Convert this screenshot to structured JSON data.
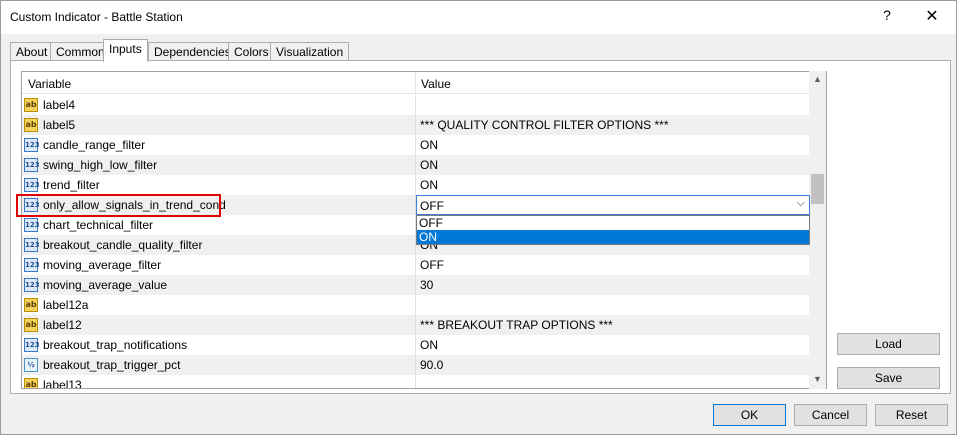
{
  "window": {
    "title": "Custom Indicator - Battle Station",
    "help_label": "?",
    "close_label": "✕"
  },
  "tabs": [
    {
      "label": "About"
    },
    {
      "label": "Common"
    },
    {
      "label": "Inputs"
    },
    {
      "label": "Dependencies"
    },
    {
      "label": "Colors"
    },
    {
      "label": "Visualization"
    }
  ],
  "active_tab": "Inputs",
  "grid": {
    "columns": {
      "variable": "Variable",
      "value": "Value"
    },
    "rows": [
      {
        "icon": "ab",
        "icon_text": "ab",
        "name": "label4",
        "value": ""
      },
      {
        "icon": "ab",
        "icon_text": "ab",
        "name": "label5",
        "value": "*** QUALITY CONTROL FILTER OPTIONS ***"
      },
      {
        "icon": "num",
        "icon_text": "123",
        "name": "candle_range_filter",
        "value": "ON"
      },
      {
        "icon": "num",
        "icon_text": "123",
        "name": "swing_high_low_filter",
        "value": "ON"
      },
      {
        "icon": "num",
        "icon_text": "123",
        "name": "trend_filter",
        "value": "ON"
      },
      {
        "icon": "num",
        "icon_text": "123",
        "name": "only_allow_signals_in_trend_cond",
        "value": ""
      },
      {
        "icon": "num",
        "icon_text": "123",
        "name": "chart_technical_filter",
        "value": ""
      },
      {
        "icon": "num",
        "icon_text": "123",
        "name": "breakout_candle_quality_filter",
        "value": "ON"
      },
      {
        "icon": "num",
        "icon_text": "123",
        "name": "moving_average_filter",
        "value": "OFF"
      },
      {
        "icon": "num",
        "icon_text": "123",
        "name": "moving_average_value",
        "value": "30"
      },
      {
        "icon": "ab",
        "icon_text": "ab",
        "name": "label12a",
        "value": ""
      },
      {
        "icon": "ab",
        "icon_text": "ab",
        "name": "label12",
        "value": "*** BREAKOUT TRAP OPTIONS ***"
      },
      {
        "icon": "num",
        "icon_text": "123",
        "name": "breakout_trap_notifications",
        "value": "ON"
      },
      {
        "icon": "frac",
        "icon_text": "½",
        "name": "breakout_trap_trigger_pct",
        "value": "90.0"
      },
      {
        "icon": "ab",
        "icon_text": "ab",
        "name": "label13",
        "value": ""
      }
    ]
  },
  "editor": {
    "selected_value": "OFF",
    "options": [
      "OFF",
      "ON"
    ],
    "highlighted_option": "ON",
    "chevron": "⌵"
  },
  "scrollbar": {
    "up": "▲",
    "down": "▼"
  },
  "buttons": {
    "load": "Load",
    "save": "Save",
    "ok": "OK",
    "cancel": "Cancel",
    "reset": "Reset"
  }
}
